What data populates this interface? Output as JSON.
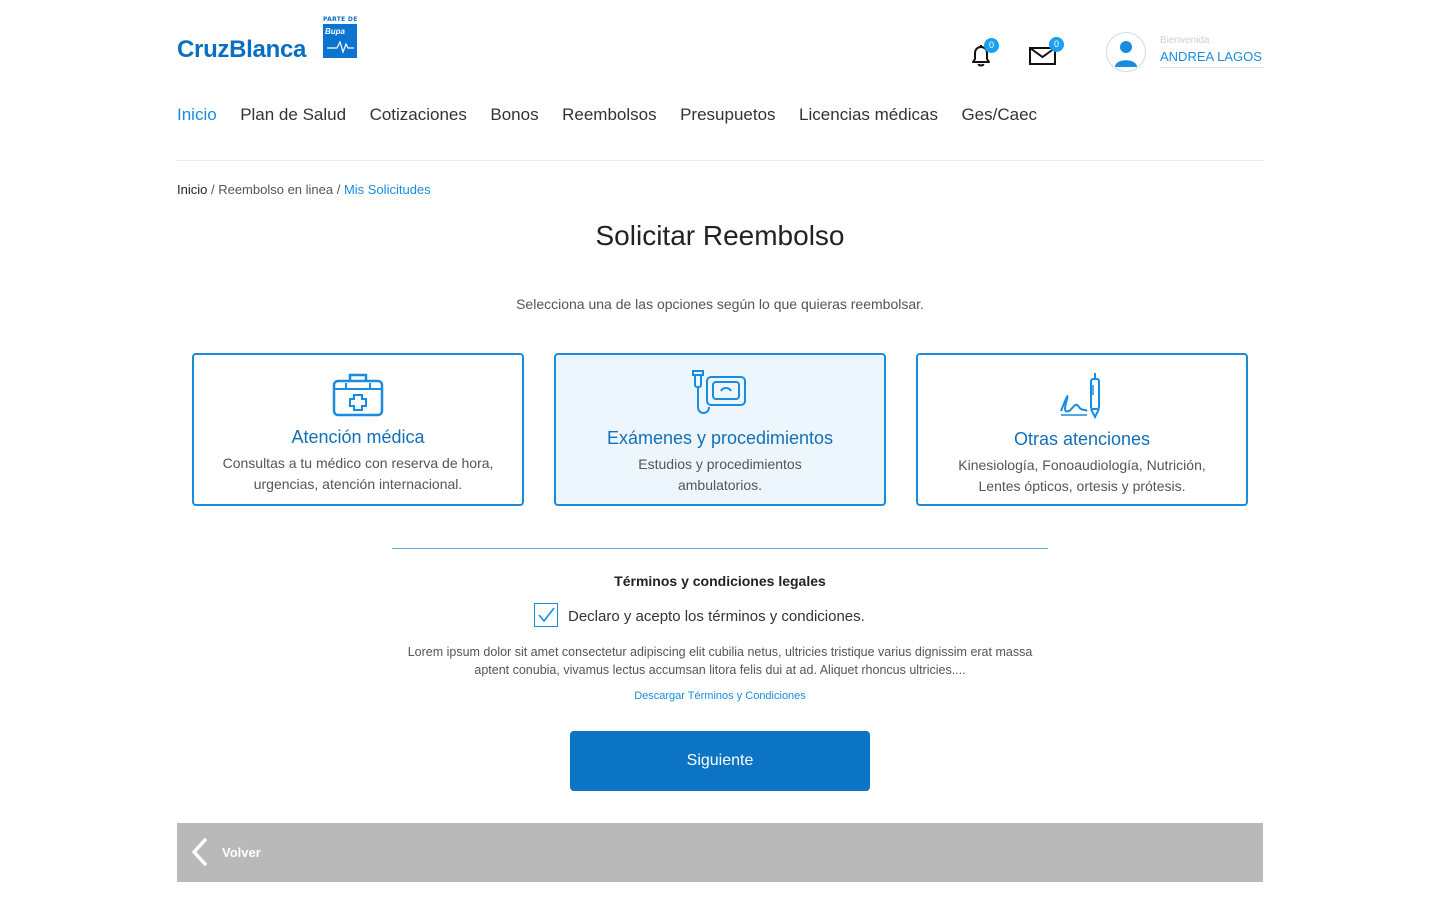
{
  "header": {
    "logo_text": "CruzBlanca",
    "logo_parte": "PARTE DE",
    "logo_bupa": "Bupa",
    "notifications_count": "0",
    "messages_count": "0",
    "welcome": "Bienvenida",
    "user_name": "ANDREA LAGOS"
  },
  "nav": {
    "items": [
      {
        "label": "Inicio",
        "active": true
      },
      {
        "label": "Plan de Salud"
      },
      {
        "label": "Cotizaciones"
      },
      {
        "label": "Bonos"
      },
      {
        "label": "Reembolsos"
      },
      {
        "label": "Presupuetos"
      },
      {
        "label": "Licencias médicas"
      },
      {
        "label": "Ges/Caec"
      }
    ]
  },
  "breadcrumb": {
    "home": "Inicio",
    "sep1": " / ",
    "middle": "Reembolso en linea",
    "sep2": " / ",
    "current": "Mis Solicitudes"
  },
  "main": {
    "title": "Solicitar Reembolso",
    "subtitle": "Selecciona una de las opciones según lo que quieras reembolsar.",
    "cards": [
      {
        "title": "Atención médica",
        "desc": "Consultas a tu médico con reserva de hora, urgencias, atención internacional.",
        "icon": "medical-kit-icon"
      },
      {
        "title": "Exámenes y procedimientos",
        "desc": "Estudios y procedimientos ambulatorios.",
        "icon": "ultrasound-icon",
        "selected": true
      },
      {
        "title": "Otras atenciones",
        "desc": "Kinesiología, Fonoaudiología, Nutrición, Lentes ópticos, ortesis y prótesis.",
        "icon": "pen-signature-icon"
      }
    ]
  },
  "terms": {
    "title": "Términos y condiciones legales",
    "checkbox_label": "Declaro y acepto los términos y condiciones.",
    "checked": true,
    "text": "Lorem ipsum dolor sit amet consectetur adipiscing elit cubilia netus, ultricies tristique varius dignissim erat massa aptent conubia, vivamus lectus accumsan litora felis dui at ad. Aliquet rhoncus ultricies....",
    "download_link": "Descargar Términos y Condiciones"
  },
  "actions": {
    "next_label": "Siguiente",
    "back_label": "Volver"
  },
  "colors": {
    "primary": "#0b74c4",
    "link": "#1a8ce0",
    "footer": "#b9b9b9"
  }
}
